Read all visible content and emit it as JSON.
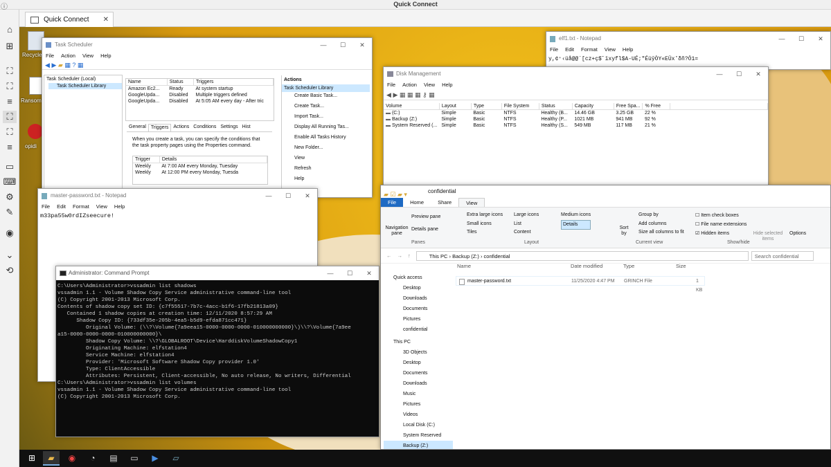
{
  "app_title": "Quick Connect",
  "tab": {
    "label": "Quick Connect",
    "close": "✕"
  },
  "desktop": {
    "recycle_label": "Recycle",
    "ransom_label": "Ransom",
    "grinch_label": "opidi"
  },
  "task_scheduler": {
    "title": "Task Scheduler",
    "menu": [
      "File",
      "Action",
      "View",
      "Help"
    ],
    "tree": [
      "Task Scheduler (Local)",
      "Task Scheduler Library"
    ],
    "columns": [
      "Name",
      "Status",
      "Triggers"
    ],
    "rows": [
      [
        "Amazon Ec2...",
        "Ready",
        "At system startup"
      ],
      [
        "GoogleUpda...",
        "Disabled",
        "Multiple triggers defined"
      ],
      [
        "GoogleUpda...",
        "Disabled",
        "At 5:05 AM every day - After tric"
      ]
    ],
    "tabs": [
      "General",
      "Triggers",
      "Actions",
      "Conditions",
      "Settings",
      "Hist"
    ],
    "info": "When you create a task, you can specify the conditions that the task property pages using the Properties command.",
    "trig_columns": [
      "Trigger",
      "Details"
    ],
    "trig_rows": [
      [
        "Weekly",
        "At 7:00 AM every Monday, Tuesday"
      ],
      [
        "Weekly",
        "At 12:00 PM every Monday, Tuesda"
      ]
    ],
    "actions_header": "Actions",
    "actions_selected": "Task Scheduler Library",
    "actions": [
      "Create Basic Task...",
      "Create Task...",
      "Import Task...",
      "Display All Running Tas...",
      "Enable All Tasks History",
      "New Folder...",
      "View",
      "Refresh",
      "Help"
    ]
  },
  "notepad1": {
    "title": "elf1.txt - Notepad",
    "menu": [
      "File",
      "Edit",
      "Format",
      "View",
      "Help"
    ],
    "content": "y,¢⁺‹üå@@`[cz+ç$˝ïxyfl$A-UÉ;\"ÉüŷÒY«EÜx˚δñ?Ö1="
  },
  "disk": {
    "title": "Disk Management",
    "menu": [
      "File",
      "Action",
      "View",
      "Help"
    ],
    "columns": [
      "Volume",
      "Layout",
      "Type",
      "File System",
      "Status",
      "Capacity",
      "Free Spa...",
      "% Free"
    ],
    "rows": [
      [
        "(C:)",
        "Simple",
        "Basic",
        "NTFS",
        "Healthy (B...",
        "14.46 GB",
        "3.25 GB",
        "22 %"
      ],
      [
        "Backup (Z:)",
        "Simple",
        "Basic",
        "NTFS",
        "Healthy (P...",
        "1021 MB",
        "941 MB",
        "92 %"
      ],
      [
        "System Reserved (...",
        "Simple",
        "Basic",
        "NTFS",
        "Healthy (S...",
        "549 MB",
        "117 MB",
        "21 %"
      ]
    ]
  },
  "notepad2": {
    "title": "master-password.txt - Notepad",
    "menu": [
      "File",
      "Edit",
      "Format",
      "View",
      "Help"
    ],
    "content": "m33pa55w0rdIZseecure!"
  },
  "cmd": {
    "title": "Administrator: Command Prompt",
    "lines": [
      "",
      "C:\\Users\\Administrator>vssadmin list shadows",
      "vssadmin 1.1 - Volume Shadow Copy Service administrative command-line tool",
      "(C) Copyright 2001-2013 Microsoft Corp.",
      "",
      "Contents of shadow copy set ID: {c7f55517-7b7c-4acc-b1f6-17fb21813a09}",
      "   Contained 1 shadow copies at creation time: 12/11/2020 8:57:29 AM",
      "      Shadow Copy ID: {733df35e-205b-4ea5-b5d9-efda871cc471}",
      "         Original Volume: (\\\\?\\Volume{7a9eea15-0000-0000-0000-010000000000}\\)\\\\?\\Volume{7a9ee",
      "a15-0000-0000-0000-010000000000}\\",
      "         Shadow Copy Volume: \\\\?\\GLOBALROOT\\Device\\HarddiskVolumeShadowCopy1",
      "         Originating Machine: elfstation4",
      "         Service Machine: elfstation4",
      "         Provider: 'Microsoft Software Shadow Copy provider 1.0'",
      "         Type: ClientAccessible",
      "         Attributes: Persistent, Client-accessible, No auto release, No writers, Differential",
      "",
      "",
      "C:\\Users\\Administrator>vssadmin list volumes",
      "vssadmin 1.1 - Volume Shadow Copy Service administrative command-line tool",
      "(C) Copyright 2001-2013 Microsoft Corp."
    ]
  },
  "explorer": {
    "title": "confidential",
    "ribbon_tabs": [
      "File",
      "Home",
      "Share",
      "View"
    ],
    "nav_pane": "Navigation pane",
    "preview": "Preview pane",
    "details_pane": "Details pane",
    "panes_label": "Panes",
    "layout": [
      "Extra large icons",
      "Large icons",
      "Medium icons",
      "Small icons",
      "List",
      "Details",
      "Tiles",
      "Content"
    ],
    "layout_label": "Layout",
    "sort": "Sort by",
    "group": "Group by",
    "add_cols": "Add columns",
    "size_cols": "Size all columns to fit",
    "current_view": "Current view",
    "check_items": [
      "Item check boxes",
      "File name extensions",
      "Hidden items"
    ],
    "hide_sel": "Hide selected items",
    "options": "Options",
    "showhide": "Show/hide",
    "path": [
      "This PC",
      "Backup (Z:)",
      "confidential"
    ],
    "search": "Search confidential",
    "columns": [
      "Name",
      "Date modified",
      "Type",
      "Size"
    ],
    "file": [
      "master-password.txt",
      "11/25/2020 4:47 PM",
      "GRINCH File",
      "1 KB"
    ],
    "nav": [
      "Quick access",
      "Desktop",
      "Downloads",
      "Documents",
      "Pictures",
      "confidential",
      "This PC",
      "3D Objects",
      "Desktop",
      "Documents",
      "Downloads",
      "Music",
      "Pictures",
      "Videos",
      "Local Disk (C:)",
      "System Reserved",
      "Backup (Z:)"
    ]
  }
}
